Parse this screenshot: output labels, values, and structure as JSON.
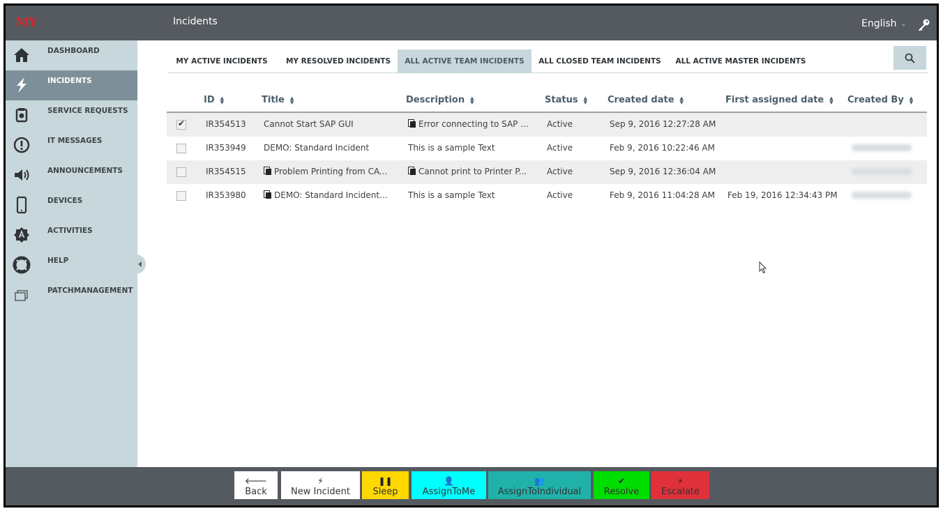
{
  "header": {
    "title": "Incidents",
    "language": "English",
    "logo_text": "MY"
  },
  "sidebar": {
    "items": [
      {
        "label": "DASHBOARD",
        "icon": "home-icon"
      },
      {
        "label": "INCIDENTS",
        "icon": "lightning-icon",
        "active": true
      },
      {
        "label": "SERVICE REQUESTS",
        "icon": "service-request-icon"
      },
      {
        "label": "IT MESSAGES",
        "icon": "exclamation-icon"
      },
      {
        "label": "ANNOUNCEMENTS",
        "icon": "speaker-icon"
      },
      {
        "label": "DEVICES",
        "icon": "mobile-device-icon"
      },
      {
        "label": "ACTIVITIES",
        "icon": "activity-badge-icon"
      },
      {
        "label": "HELP",
        "icon": "lifebuoy-icon"
      },
      {
        "label": "PATCHMANAGEMENT",
        "icon": "windows-stack-icon"
      }
    ]
  },
  "tabs": [
    {
      "label": "MY ACTIVE INCIDENTS"
    },
    {
      "label": "MY RESOLVED INCIDENTS"
    },
    {
      "label": "ALL ACTIVE TEAM INCIDENTS",
      "active": true
    },
    {
      "label": "ALL CLOSED TEAM INCIDENTS"
    },
    {
      "label": "ALL ACTIVE MASTER INCIDENTS"
    }
  ],
  "table": {
    "columns": [
      "ID",
      "Title",
      "Description",
      "Status",
      "Created date",
      "First assigned date",
      "Created By"
    ],
    "rows": [
      {
        "checked": true,
        "id": "IR354513",
        "title": "Cannot Start SAP GUI",
        "title_icon": false,
        "description": "Error connecting to SAP S...",
        "desc_icon": true,
        "status": "Active",
        "created": "Sep 9, 2016 12:27:28 AM",
        "first_assigned": "",
        "created_by_hidden": false
      },
      {
        "checked": false,
        "id": "IR353949",
        "title": "DEMO: Standard Incident",
        "title_icon": false,
        "description": "This is a sample Text",
        "desc_icon": false,
        "status": "Active",
        "created": "Feb 9, 2016 10:22:46 AM",
        "first_assigned": "",
        "created_by_hidden": true
      },
      {
        "checked": false,
        "id": "IR354515",
        "title": "Problem Printing from CAT...",
        "title_icon": true,
        "description": "Cannot print to Printer P...",
        "desc_icon": true,
        "status": "Active",
        "created": "Sep 9, 2016 12:36:04 AM",
        "first_assigned": "",
        "created_by_hidden": true
      },
      {
        "checked": false,
        "id": "IR353980",
        "title": "DEMO: Standard Incident S...",
        "title_icon": true,
        "description": "This is a sample Text",
        "desc_icon": false,
        "status": "Active",
        "created": "Feb 9, 2016 11:04:28 AM",
        "first_assigned": "Feb 19, 2016 12:34:43 PM",
        "created_by_hidden": true
      }
    ]
  },
  "actions": [
    {
      "label": "Back",
      "icon": "arrow-left-icon",
      "glyph": "🡐",
      "bg": "#ffffff"
    },
    {
      "label": "New Incident",
      "icon": "lightning-icon",
      "glyph": "⚡",
      "bg": "#ffffff"
    },
    {
      "label": "Sleep",
      "icon": "pause-icon",
      "glyph": "❚❚",
      "bg": "#ffd800"
    },
    {
      "label": "AssignToMe",
      "icon": "user-icon",
      "glyph": "👤",
      "bg": "#00ffff"
    },
    {
      "label": "AssignToIndividual",
      "icon": "users-icon",
      "glyph": "👥",
      "bg": "#20b2aa"
    },
    {
      "label": "Resolve",
      "icon": "checkmark-icon",
      "glyph": "✔",
      "bg": "#00dd00"
    },
    {
      "label": "Escalate",
      "icon": "lightning-icon",
      "glyph": "⚡",
      "bg": "#e0313b"
    }
  ]
}
